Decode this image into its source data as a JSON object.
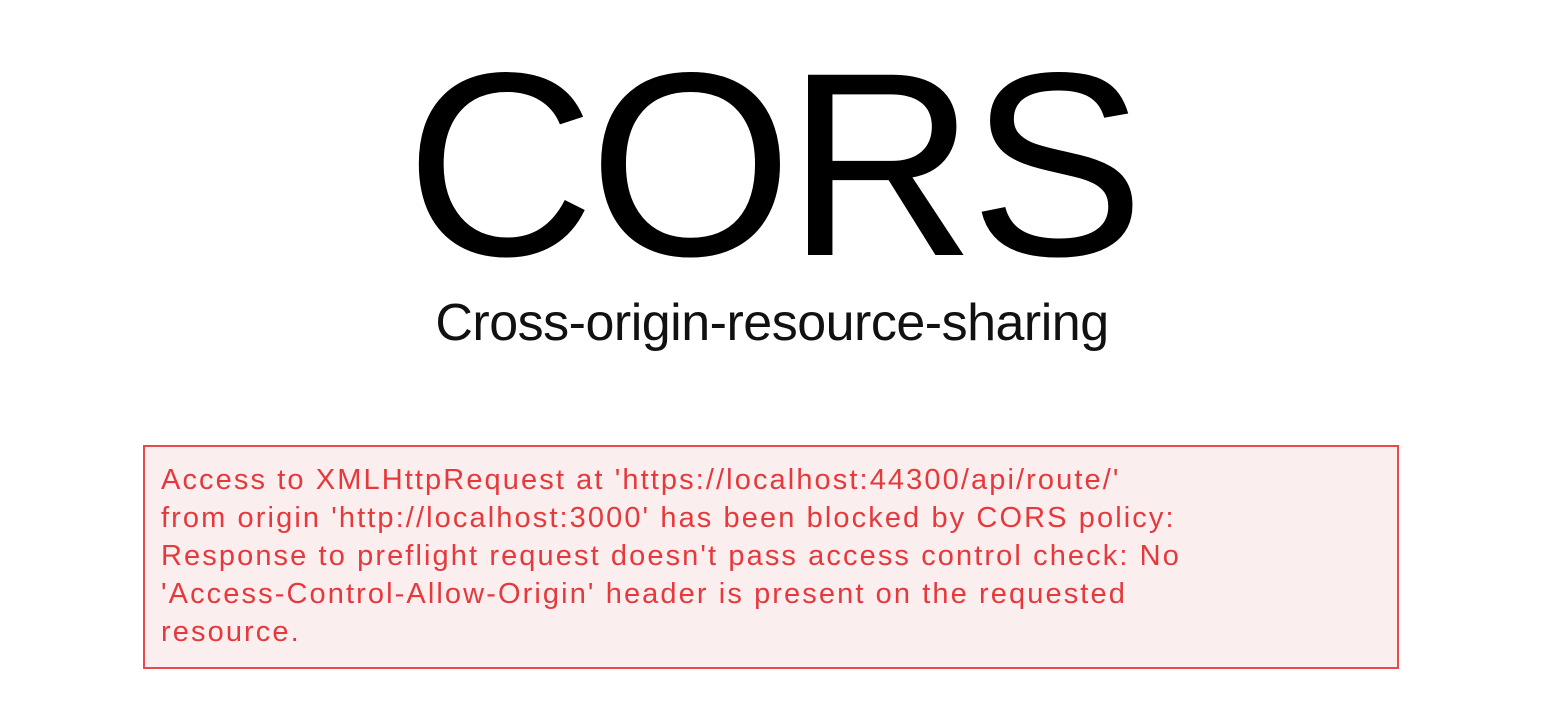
{
  "heading": {
    "title": "CORS",
    "subtitle": "Cross-origin-resource-sharing"
  },
  "error": {
    "lines": [
      "Access to XMLHttpRequest at 'https://localhost:44300/api/route/'",
      "from origin 'http://localhost:3000' has been blocked by CORS policy:",
      "Response to preflight request doesn't pass access control check: No",
      "'Access-Control-Allow-Origin' header is present on the requested",
      "resource."
    ],
    "text_color": "#e5393c",
    "border_color": "#e8494c",
    "background_color": "#fbeeee"
  }
}
